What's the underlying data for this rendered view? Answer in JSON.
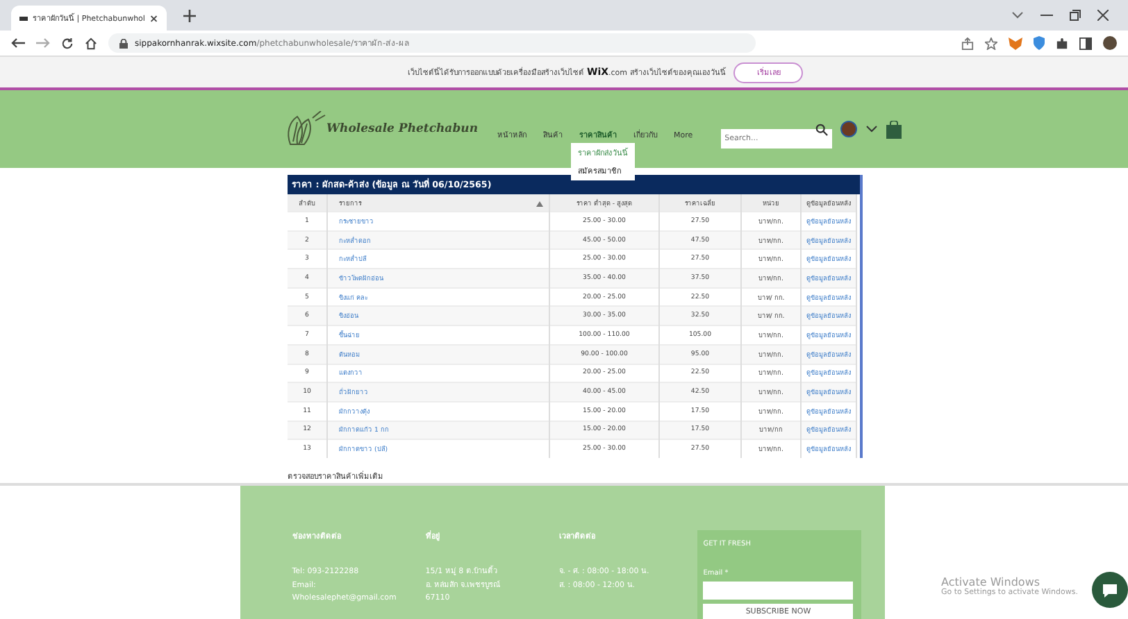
{
  "browser": {
    "tab_title": "ราคาผักวันนี้ | Phetchabunwhol",
    "url_host": "sippakornhanrak.wixsite.com",
    "url_path": "/phetchabunwholesale/ราคาผัก-ส่ง-ผล"
  },
  "wix_banner": {
    "text": "เว็บไซต์นี้ได้รับการออกแบบด้วยเครื่องมือสร้างเว็บไซต์",
    "brand": "WiX",
    "brand_suffix": ".com",
    "text_after": "สร้างเว็บไซต์ของคุณเองวันนี้",
    "button": "เริ่มเลย"
  },
  "header": {
    "logo": "Wholesale Phetchabun",
    "search_placeholder": "Search...",
    "nav": [
      {
        "label": "หน้าหลัก",
        "selected": false
      },
      {
        "label": "สินค้า",
        "selected": false
      },
      {
        "label": "ราคาสินค้า",
        "selected": true
      },
      {
        "label": "เกี่ยวกับ",
        "selected": false
      },
      {
        "label": "More",
        "selected": false
      }
    ],
    "dropdown": [
      {
        "label": "ราคาผักส่งวันนี้",
        "selected": true
      },
      {
        "label": "สมัครสมาชิก",
        "selected": false
      }
    ]
  },
  "table": {
    "title": "ราคา : ผักสด-ค้าส่ง (ข้อมูล ณ วันที่ 06/10/2565)",
    "columns": [
      "ลำดับ",
      "รายการ",
      "ราคา ต่ำสุด - สูงสุด",
      "ราคาเฉลี่ย",
      "หน่วย",
      "ดูข้อมูลย้อนหลัง"
    ],
    "rows": [
      [
        "1",
        "กระชายขาว",
        "25.00 - 30.00",
        "27.50",
        "บาท/กก.",
        "ดูข้อมูลย้อนหลัง"
      ],
      [
        "2",
        "กะหล่ำดอก",
        "45.00 - 50.00",
        "47.50",
        "บาท/กก.",
        "ดูข้อมูลย้อนหลัง"
      ],
      [
        "3",
        "กะหล่ำปลี",
        "25.00 - 30.00",
        "27.50",
        "บาท/กก.",
        "ดูข้อมูลย้อนหลัง"
      ],
      [
        "4",
        "ข้าวโพดฝักอ่อน",
        "35.00 - 40.00",
        "37.50",
        "บาท/กก.",
        "ดูข้อมูลย้อนหลัง"
      ],
      [
        "5",
        "ขิงแก่ คละ",
        "20.00 - 25.00",
        "22.50",
        "บาท/ กก.",
        "ดูข้อมูลย้อนหลัง"
      ],
      [
        "6",
        "ขิงอ่อน",
        "30.00 - 35.00",
        "32.50",
        "บาท/ กก.",
        "ดูข้อมูลย้อนหลัง"
      ],
      [
        "7",
        "ขึ้นฉ่าย",
        "100.00 - 110.00",
        "105.00",
        "บาท/กก.",
        "ดูข้อมูลย้อนหลัง"
      ],
      [
        "8",
        "ต้นหอม",
        "90.00 - 100.00",
        "95.00",
        "บาท/กก.",
        "ดูข้อมูลย้อนหลัง"
      ],
      [
        "9",
        "แตงกวา",
        "20.00 - 25.00",
        "22.50",
        "บาท/กก.",
        "ดูข้อมูลย้อนหลัง"
      ],
      [
        "10",
        "ถั่วฝักยาว",
        "40.00 - 45.00",
        "42.50",
        "บาท/กก.",
        "ดูข้อมูลย้อนหลัง"
      ],
      [
        "11",
        "ผักกวางตุ้ง",
        "15.00 - 20.00",
        "17.50",
        "บาท/กก.",
        "ดูข้อมูลย้อนหลัง"
      ],
      [
        "12",
        "ผักกาดแก้ว 1 กก",
        "15.00 - 20.00",
        "17.50",
        "บาท/กก",
        "ดูข้อมูลย้อนหลัง"
      ],
      [
        "13",
        "ผักกาดขาว (ปลี)",
        "25.00 - 30.00",
        "27.50",
        "บาท/กก.",
        "ดูข้อมูลย้อนหลัง"
      ]
    ]
  },
  "more_prices": "ตรวจสอบราคาสินค้าเพิ่มเติม",
  "footer": {
    "columns": [
      {
        "heading": "ช่องทางติดต่อ",
        "lines": [
          "Tel: 093-2122288",
          "Email:",
          "Wholesalephet@gmail.com"
        ]
      },
      {
        "heading": "ที่อยู่",
        "lines": [
          "15/1 หมู่ 8 ต.บ้านติ้ว",
          "อ. หล่มสัก จ.เพชรบูรณ์",
          "67110"
        ]
      },
      {
        "heading": "เวลาติดต่อ",
        "lines": [
          "จ. - ศ. : 08:00 - 18:00 น.",
          "ส. : 08:00 - 12:00 น."
        ]
      }
    ],
    "subscribe": {
      "title": "GET IT FRESH",
      "email_label": "Email *",
      "button": "SUBSCRIBE NOW"
    }
  },
  "activate_windows": {
    "title": "Activate Windows",
    "subtitle": "Go to Settings to activate Windows."
  }
}
